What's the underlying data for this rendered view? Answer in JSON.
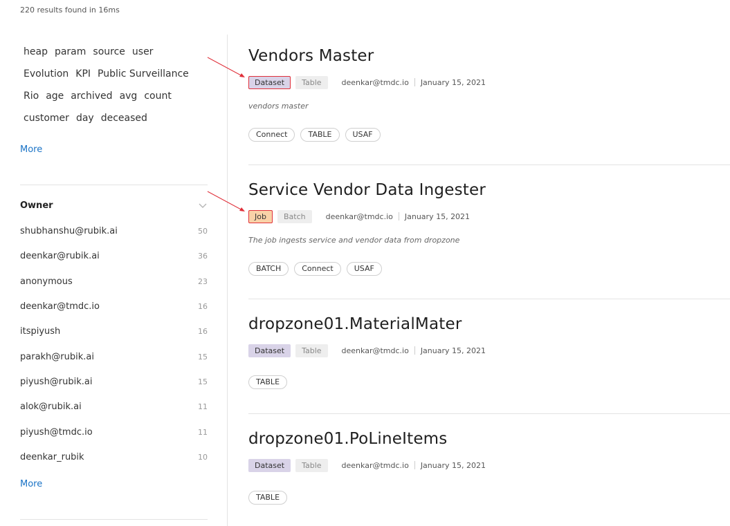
{
  "results_text": "220 results found in 16ms",
  "tags": {
    "rows": [
      [
        "heap",
        "param",
        "source",
        "user"
      ],
      [
        "Evolution",
        "KPI",
        "Public Surveillance"
      ],
      [
        "Rio",
        "age",
        "archived",
        "avg",
        "count"
      ],
      [
        "customer",
        "day",
        "deceased"
      ]
    ],
    "more_label": "More"
  },
  "owner": {
    "title": "Owner",
    "items": [
      {
        "name": "shubhanshu@rubik.ai",
        "count": "50"
      },
      {
        "name": "deenkar@rubik.ai",
        "count": "36"
      },
      {
        "name": "anonymous",
        "count": "23"
      },
      {
        "name": "deenkar@tmdc.io",
        "count": "16"
      },
      {
        "name": "itspiyush",
        "count": "16"
      },
      {
        "name": "parakh@rubik.ai",
        "count": "15"
      },
      {
        "name": "piyush@rubik.ai",
        "count": "15"
      },
      {
        "name": "alok@rubik.ai",
        "count": "11"
      },
      {
        "name": "piyush@tmdc.io",
        "count": "11"
      },
      {
        "name": "deenkar_rubik",
        "count": "10"
      }
    ],
    "more_label": "More"
  },
  "results": [
    {
      "title": "Vendors Master",
      "type": "Dataset",
      "subtype": "Table",
      "owner": "deenkar@tmdc.io",
      "date": "January 15, 2021",
      "description": "vendors master",
      "tags": [
        "Connect",
        "TABLE",
        "USAF"
      ]
    },
    {
      "title": "Service Vendor Data Ingester",
      "type": "Job",
      "subtype": "Batch",
      "owner": "deenkar@tmdc.io",
      "date": "January 15, 2021",
      "description": "The job ingests service and vendor data from dropzone",
      "tags": [
        "BATCH",
        "Connect",
        "USAF"
      ]
    },
    {
      "title": "dropzone01.MaterialMater",
      "type": "Dataset",
      "subtype": "Table",
      "owner": "deenkar@tmdc.io",
      "date": "January 15, 2021",
      "description": "",
      "tags": [
        "TABLE"
      ]
    },
    {
      "title": "dropzone01.PoLineItems",
      "type": "Dataset",
      "subtype": "Table",
      "owner": "deenkar@tmdc.io",
      "date": "January 15, 2021",
      "description": "",
      "tags": [
        "TABLE"
      ]
    }
  ],
  "colors": {
    "accent_link": "#1a73c6",
    "badge_dataset": "#d9d3e8",
    "badge_job": "#f9d2a8",
    "annotation": "#e0303a"
  }
}
